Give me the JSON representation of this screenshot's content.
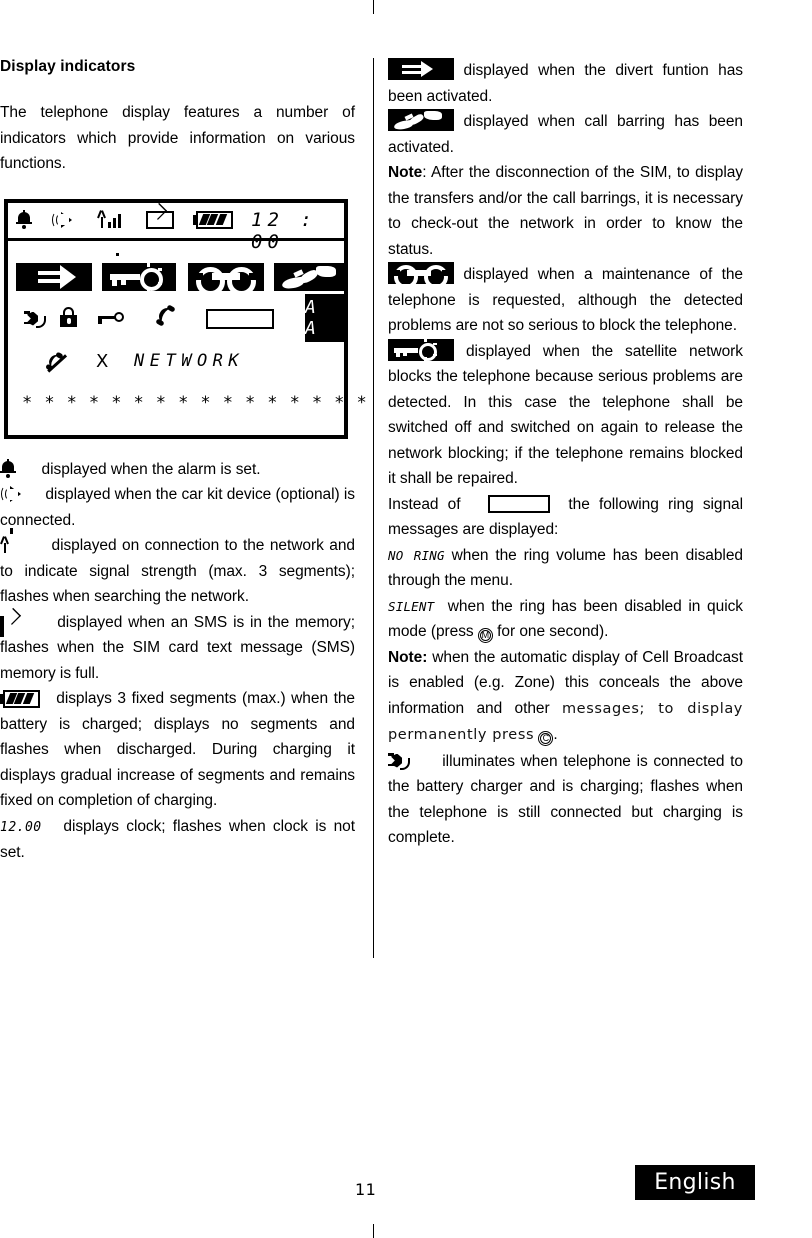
{
  "page": {
    "number": "11",
    "language_badge": "English"
  },
  "left_column": {
    "heading": "Display indicators",
    "intro": "The telephone display features a number of indicators which provide information on various functions.",
    "lcd_display": {
      "status_bar": {
        "icons": [
          "bell-icon",
          "car-kit-icon",
          "signal-strength-icon",
          "envelope-icon",
          "battery-icon"
        ],
        "clock": "12 : 00"
      },
      "row_inverted_icons": [
        "divert-icon",
        "satellite-key-icon",
        "wrench-icon",
        "call-barring-icon"
      ],
      "row_outline_icons": [
        "plug-icon",
        "padlock-icon",
        "key-icon",
        "handset-icon",
        "ring-field-box",
        "aa-indicator"
      ],
      "aa_indicator": "A A",
      "row_network": {
        "no_call_icon": "crossed-handset-icon",
        "x": "X",
        "network_label": "NETWORK"
      },
      "stars_row": "* * * * * * * * * * * * * * * *",
      "star_count": 16
    },
    "definitions": [
      {
        "icon": "bell-icon",
        "text": "displayed when the alarm is set."
      },
      {
        "icon": "car-kit-icon",
        "text": "displayed when the car kit device (optional) is connected."
      },
      {
        "icon": "signal-strength-icon",
        "text": "displayed on connection to the network and to indicate signal strength (max. 3 segments); flashes when searching the network."
      },
      {
        "icon": "envelope-icon",
        "text": "displayed when an SMS is in the memory; flashes when the SIM card text message (SMS) memory is full."
      },
      {
        "icon": "battery-icon",
        "text": "displays 3 fixed segments (max.) when the battery is charged; displays no segments and flashes when discharged. During charging it displays gradual increase of segments and remains fixed on completion of charging."
      },
      {
        "icon": "clock-lcd-text",
        "lcd_label": "12.00",
        "text": "displays clock; flashes when clock is not set."
      }
    ]
  },
  "right_column": {
    "definitions": [
      {
        "icon": "divert-icon",
        "text": "displayed when the divert funtion has been activated."
      },
      {
        "icon": "call-barring-icon",
        "text": "displayed when call barring has been activated."
      },
      {
        "note_label": "Note",
        "note_sep": ": ",
        "text": "After the disconnection of the SIM, to display the transfers and/or the call barrings, it is necessary to check-out the network in order to know the status."
      },
      {
        "icon": "wrench-icon",
        "text": "displayed when a maintenance of the telephone is requested, although the detected problems are not so serious to block the telephone."
      },
      {
        "icon": "satellite-key-icon",
        "text": "displayed when the satellite network blocks the telephone because serious problems are detected. In this case the telephone shall be switched off and switched on again to release  the network blocking; if the telephone remains blocked it shall be repaired."
      }
    ],
    "instead_of": {
      "prefix": "Instead of",
      "box": "ring-field-box",
      "suffix": "the following ring signal messages are displayed:"
    },
    "ring_messages": [
      {
        "lcd_label": "NO RING",
        "text": "when the ring volume has been disabled through the menu."
      },
      {
        "lcd_label": "SILENT",
        "text_before": "when the ring has been disabled in quick mode (press",
        "key": "M",
        "text_after": "for one second)."
      }
    ],
    "cell_broadcast_note": {
      "note_label": "Note:",
      "text_plain": "when the automatic display of Cell Broadcast is enabled (e.g. Zone) this conceals the above information and other",
      "text_lcd": "messages; to display permanently press",
      "key": "C",
      "text_end": "."
    },
    "charging": {
      "icon": "plug-icon",
      "text": "illuminates when telephone is connected to the battery charger and is charging; flashes when the telephone is still connected but charging is complete."
    }
  }
}
